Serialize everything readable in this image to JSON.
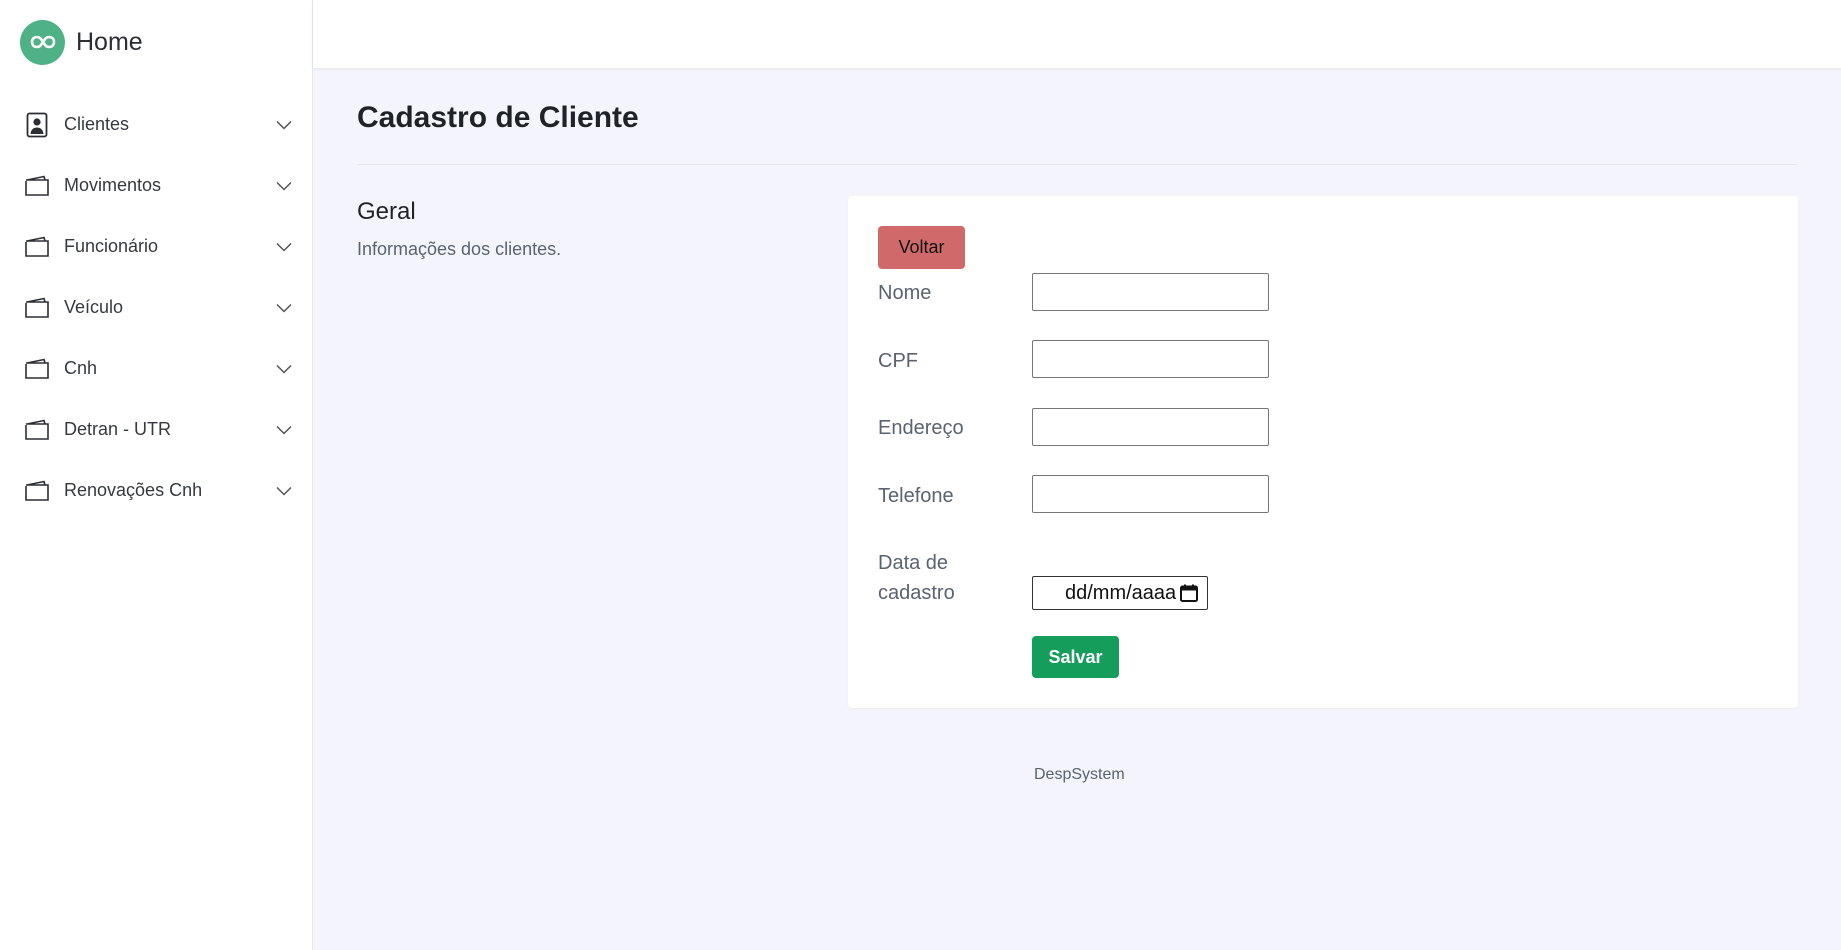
{
  "brand": {
    "title": "Home",
    "logo_icon": "infinity-icon",
    "accent": "#4fb286"
  },
  "sidebar": {
    "items": [
      {
        "label": "Clientes",
        "icon": "contact-card-icon"
      },
      {
        "label": "Movimentos",
        "icon": "wallet-icon"
      },
      {
        "label": "Funcionário",
        "icon": "wallet-icon"
      },
      {
        "label": "Veículo",
        "icon": "wallet-icon"
      },
      {
        "label": "Cnh",
        "icon": "wallet-icon"
      },
      {
        "label": "Detran - UTR",
        "icon": "wallet-icon"
      },
      {
        "label": "Renovações Cnh",
        "icon": "wallet-icon"
      }
    ]
  },
  "page": {
    "title": "Cadastro de Cliente"
  },
  "section": {
    "title": "Geral",
    "description": "Informações dos clientes."
  },
  "form": {
    "back_label": "Voltar",
    "back_color": "#d06a6a",
    "fields": [
      {
        "label": "Nome",
        "value": ""
      },
      {
        "label": "CPF",
        "value": ""
      },
      {
        "label": "Endereço",
        "value": ""
      },
      {
        "label": "Telefone",
        "value": ""
      }
    ],
    "date_label_line1": "Data de",
    "date_label_line2": "cadastro",
    "date_placeholder": "dd/mm/aaaa",
    "save_label": "Salvar",
    "save_color": "#159e5b"
  },
  "footer": {
    "text": "DespSystem"
  }
}
